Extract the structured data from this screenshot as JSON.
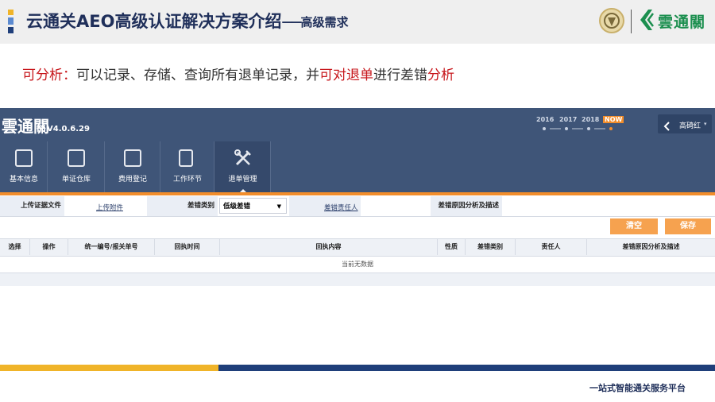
{
  "slide": {
    "title": "云通关AEO高级认证解决方案介绍",
    "title_dash": "——",
    "title_sub": "高级需求",
    "logo_text": "雲通關",
    "feature": {
      "part1": "可分析：",
      "part2": "可以记录、存储、查询所有退单记录，并",
      "part3": "可对退单",
      "part4": "进行差错",
      "part5": "分析"
    },
    "tagline": "一站式智能通关服务平台"
  },
  "app": {
    "brand": "雲通關",
    "version": "V4.0.6.29",
    "years": [
      "2016",
      "2017",
      "2018"
    ],
    "now_label": "NOW",
    "user": "高碕红",
    "nav": [
      {
        "label": "基本信息",
        "icon": "info-icon"
      },
      {
        "label": "单证仓库",
        "icon": "warehouse-icon"
      },
      {
        "label": "费用登记",
        "icon": "fee-icon"
      },
      {
        "label": "工作环节",
        "icon": "checklist-icon"
      },
      {
        "label": "退单管理",
        "icon": "tools-icon"
      }
    ]
  },
  "form": {
    "upload_label": "上传证据文件",
    "upload_link": "上传附件",
    "error_type_label": "差错类别",
    "error_type_value": "低级差错",
    "responsible_link": "差错责任人",
    "analysis_label": "差错原因分析及描述",
    "clear_button": "清空",
    "save_button": "保存"
  },
  "table": {
    "headers": [
      "选择",
      "操作",
      "统一编号/报关单号",
      "回执时间",
      "回执内容",
      "性质",
      "差错类别",
      "责任人",
      "差错原因分析及描述"
    ],
    "empty_text": "当前无数据"
  },
  "colors": {
    "header_bg": "#3f5578",
    "accent_orange": "#f28d2b",
    "title_navy": "#1f2f5a",
    "highlight_red": "#c7161b",
    "footer_yellow": "#f0b429",
    "footer_blue": "#1f3f7a"
  }
}
